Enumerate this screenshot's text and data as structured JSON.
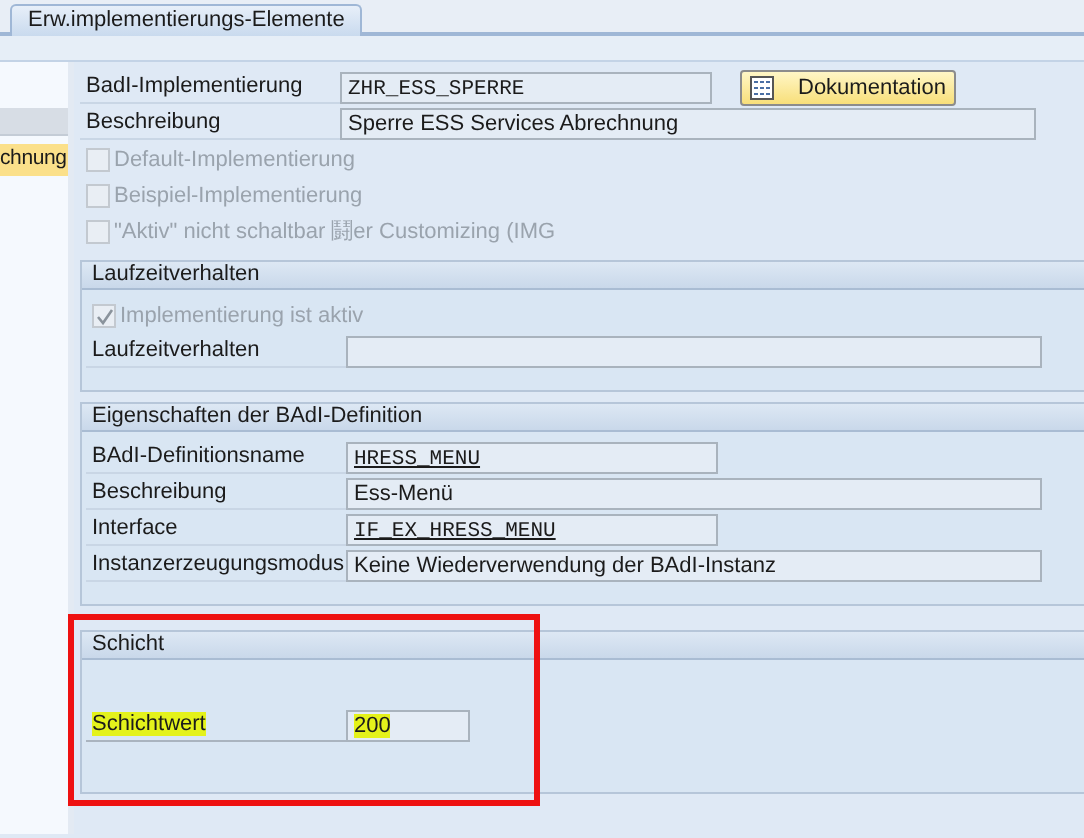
{
  "tabs": [
    {
      "label": "Erw.implementierungs-Elemente",
      "selected": true
    }
  ],
  "sidebar": {
    "items": [
      {
        "kind": "header"
      },
      {
        "kind": "item",
        "label": "chnung",
        "selected": true
      }
    ]
  },
  "header_fields": [
    {
      "label": "BadI-Implementierung",
      "value": "ZHR_ESS_SPERRE",
      "kind": "code"
    },
    {
      "label": "Beschreibung",
      "value": "Sperre ESS Services Abrechnung",
      "kind": "text"
    }
  ],
  "documentation_button": {
    "label": "Dokumentation"
  },
  "checkboxes": [
    {
      "label": "Default-Implementierung",
      "checked": false,
      "disabled": true
    },
    {
      "label": "Beispiel-Implementierung",
      "checked": false,
      "disabled": true
    },
    {
      "label": "\"Aktiv\" nicht schaltbar 鬪er Customizing (IMG",
      "checked": false,
      "disabled": true
    }
  ],
  "groups": [
    {
      "title": "Laufzeitverhalten",
      "annotated": false,
      "checkboxes": [
        {
          "label": "Implementierung ist aktiv",
          "checked": true,
          "disabled": true
        }
      ],
      "fields": [
        {
          "label": "Laufzeitverhalten",
          "kind": "text"
        }
      ]
    },
    {
      "title": "Eigenschaften der BAdI-Definition",
      "annotated": false,
      "fields": [
        {
          "label": "BAdI-Definitionsname",
          "value": "HRESS_MENU",
          "kind": "link"
        },
        {
          "label": "Beschreibung",
          "value": "Ess-Menü",
          "kind": "text"
        },
        {
          "label": "Interface",
          "value": "IF_EX_HRESS_MENU",
          "kind": "link"
        },
        {
          "label": "Instanzerzeugungsmodus",
          "value": "Keine Wiederverwendung der BAdI-Instanz",
          "kind": "text"
        }
      ]
    },
    {
      "title": "Schicht",
      "annotated": true,
      "fields": [
        {
          "label": "Schichtwert",
          "value": "200",
          "kind": "number",
          "highlighted": true
        }
      ]
    }
  ]
}
